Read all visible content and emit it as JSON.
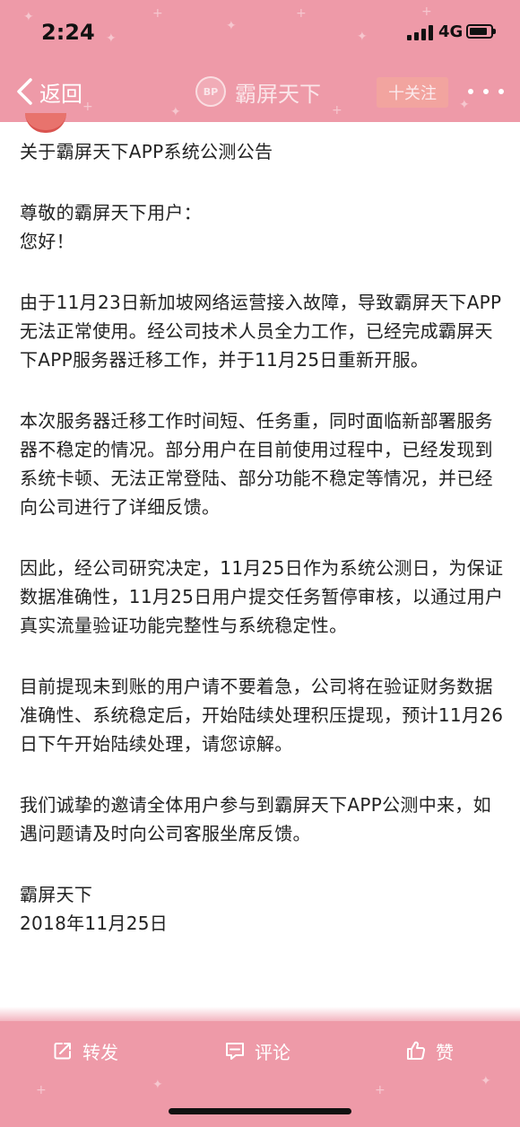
{
  "status_bar": {
    "time": "2:24",
    "network": "4G",
    "battery_level_percent": 85,
    "signal_bars": 4
  },
  "nav": {
    "back_label": "返回",
    "account_name": "霸屏天下",
    "avatar_text": "BP",
    "follow_label": "十关注"
  },
  "article": {
    "title": "关于霸屏天下APP系统公测公告",
    "greeting": "尊敬的霸屏天下用户：",
    "hello": "您好！",
    "paragraphs": [
      "由于11月23日新加坡网络运营接入故障，导致霸屏天下APP无法正常使用。经公司技术人员全力工作，已经完成霸屏天下APP服务器迁移工作，并于11月25日重新开服。",
      "本次服务器迁移工作时间短、任务重，同时面临新部署服务器不稳定的情况。部分用户在目前使用过程中，已经发现到系统卡顿、无法正常登陆、部分功能不稳定等情况，并已经向公司进行了详细反馈。",
      "因此，经公司研究决定，11月25日作为系统公测日，为保证数据准确性，11月25日用户提交任务暂停审核，以通过用户真实流量验证功能完整性与系统稳定性。",
      "目前提现未到账的用户请不要着急，公司将在验证财务数据准确性、系统稳定后，开始陆续处理积压提现，预计11月26日下午开始陆续处理，请您谅解。",
      "我们诚挚的邀请全体用户参与到霸屏天下APP公测中来，如遇问题请及时向公司客服坐席反馈。"
    ],
    "signature": "霸屏天下",
    "date": "2018年11月25日"
  },
  "actions": {
    "share_label": "转发",
    "comment_label": "评论",
    "like_label": "赞"
  },
  "colors": {
    "header_pink": "#ee9aa8",
    "text": "#222222",
    "white": "#ffffff"
  }
}
